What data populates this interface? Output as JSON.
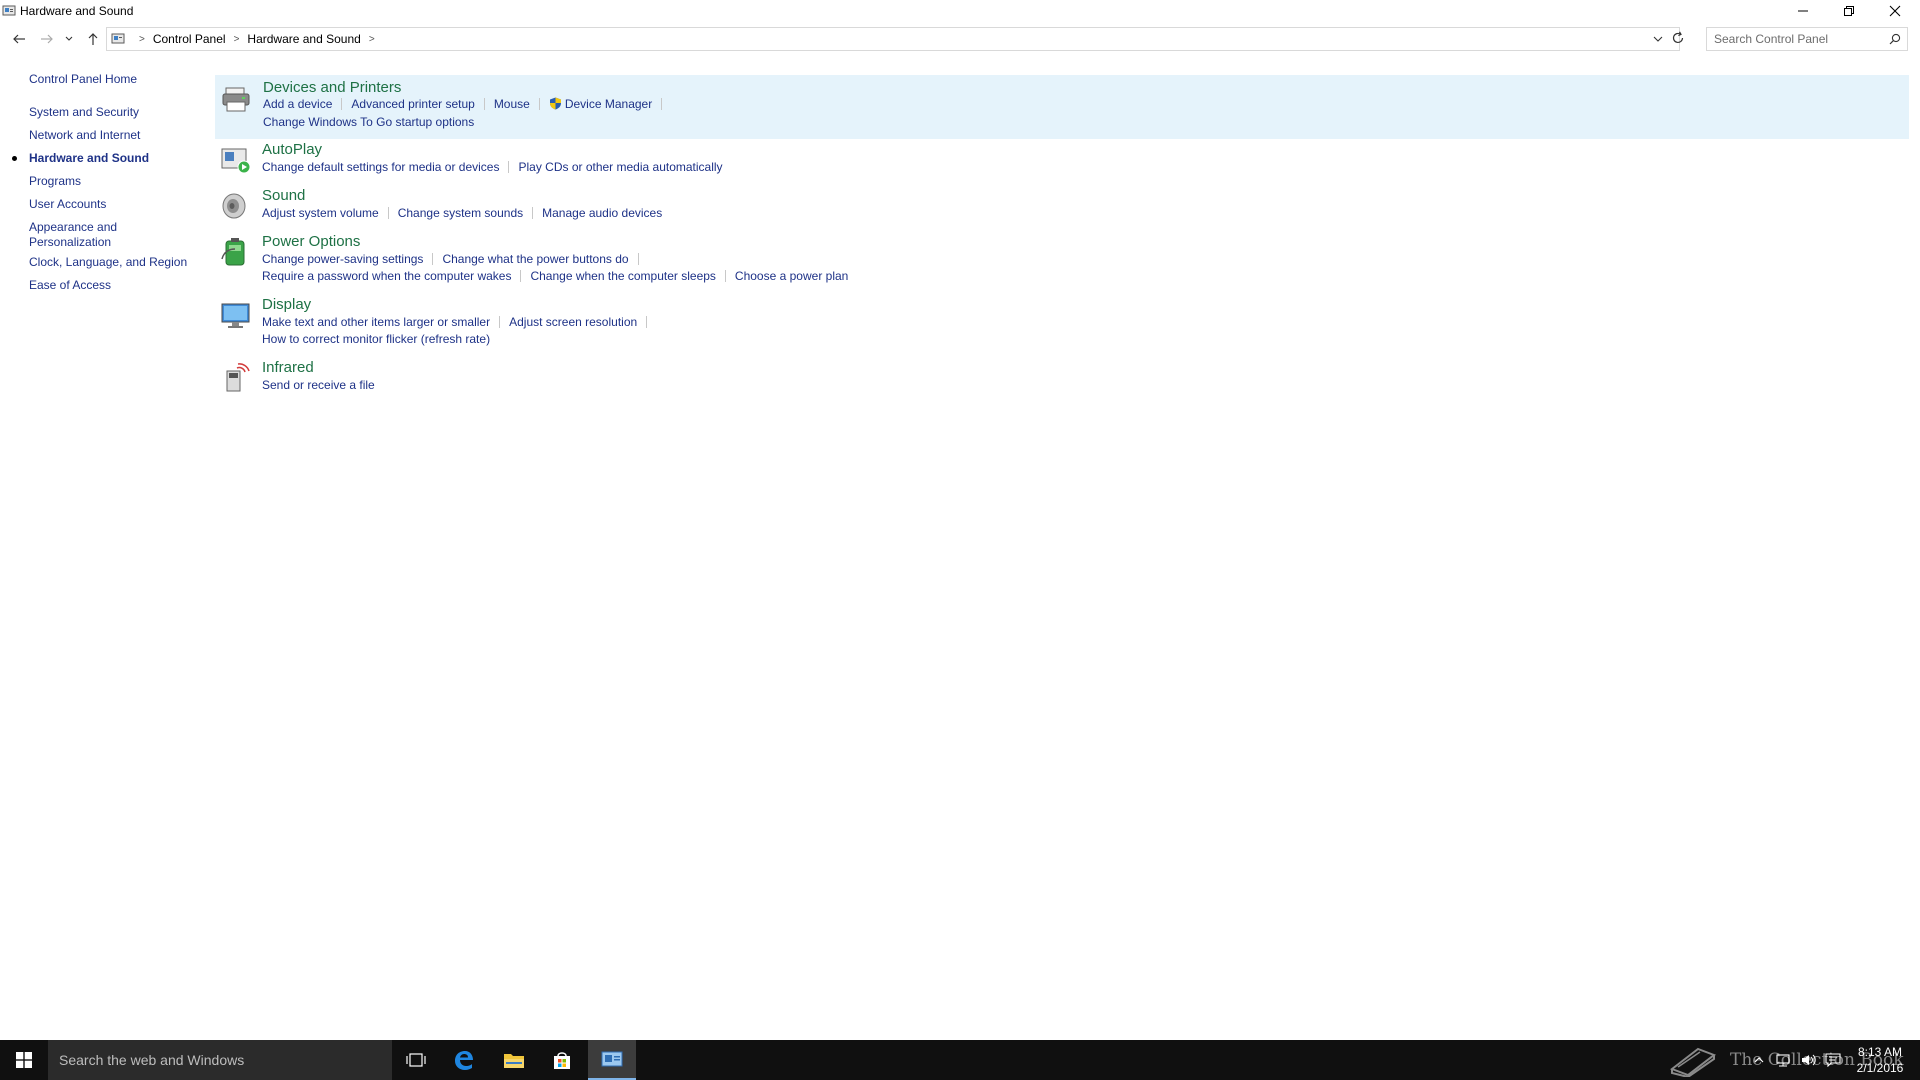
{
  "window": {
    "title": "Hardware and Sound"
  },
  "address": {
    "crumbs": [
      "Control Panel",
      "Hardware and Sound"
    ]
  },
  "search": {
    "placeholder": "Search Control Panel"
  },
  "leftnav": {
    "home": "Control Panel Home",
    "items": [
      "System and Security",
      "Network and Internet",
      "Hardware and Sound",
      "Programs",
      "User Accounts",
      "Appearance and Personalization",
      "Clock, Language, and Region",
      "Ease of Access"
    ],
    "appearance_line1": "Appearance and",
    "appearance_line2": "Personalization"
  },
  "categories": {
    "devices": {
      "title": "Devices and Printers",
      "links": [
        "Add a device",
        "Advanced printer setup",
        "Mouse",
        "Device Manager",
        "Change Windows To Go startup options"
      ]
    },
    "autoplay": {
      "title": "AutoPlay",
      "links": [
        "Change default settings for media or devices",
        "Play CDs or other media automatically"
      ]
    },
    "sound": {
      "title": "Sound",
      "links": [
        "Adjust system volume",
        "Change system sounds",
        "Manage audio devices"
      ]
    },
    "power": {
      "title": "Power Options",
      "links": [
        "Change power-saving settings",
        "Change what the power buttons do",
        "Require a password when the computer wakes",
        "Change when the computer sleeps",
        "Choose a power plan"
      ]
    },
    "display": {
      "title": "Display",
      "links": [
        "Make text and other items larger or smaller",
        "Adjust screen resolution",
        "How to correct monitor flicker (refresh rate)"
      ]
    },
    "infrared": {
      "title": "Infrared",
      "links": [
        "Send or receive a file"
      ]
    }
  },
  "taskbar": {
    "search_placeholder": "Search the web and Windows",
    "watermark": "The Collection Book",
    "time": "8:13 AM",
    "date": "2/1/2016"
  },
  "colors": {
    "link": "#1e3287",
    "category_title": "#1e7145",
    "highlight": "#e5f3fb",
    "taskbar": "#101010"
  }
}
